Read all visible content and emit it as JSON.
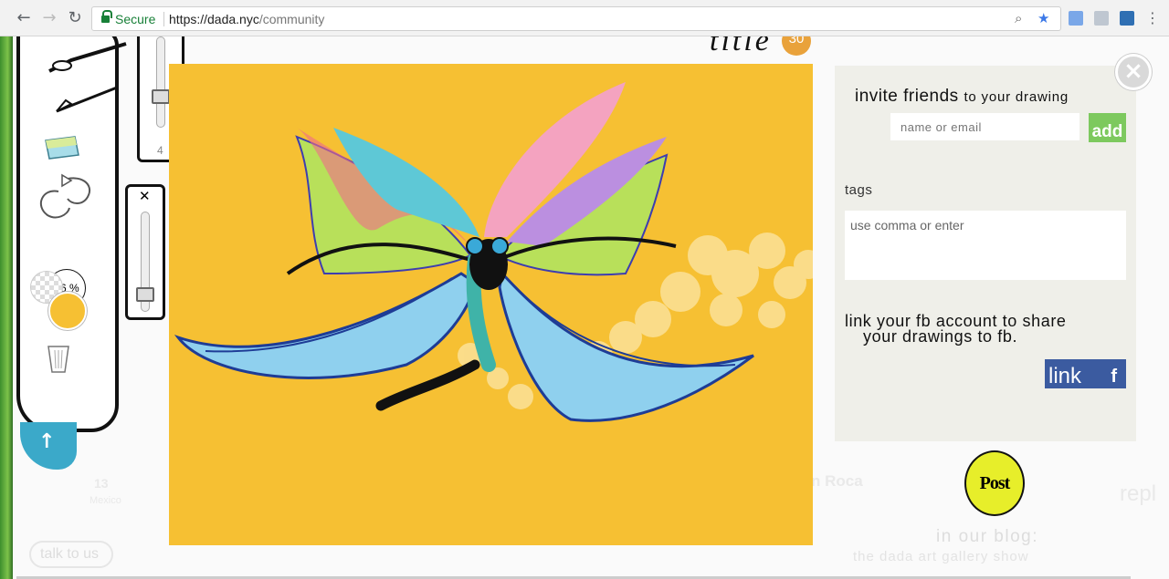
{
  "browser": {
    "secure_label": "Secure",
    "url_scheme_host": "https://dada.nyc",
    "url_path": "/community"
  },
  "toolbar": {
    "brush_size": "4",
    "zoom": "16 %",
    "color_swatch": "#f6c033",
    "close_symbol": "✕"
  },
  "header": {
    "title_word": "title",
    "counter": "30"
  },
  "panel": {
    "invite_main": "invite friends",
    "invite_suffix": "to your drawing",
    "invite_placeholder": "name or email",
    "add_label": "add",
    "tags_label": "tags",
    "tags_placeholder": "use comma or enter",
    "fb_line1": "link your fb account to share",
    "fb_line2": "your drawings to fb.",
    "link_label": "link",
    "link_icon": "f"
  },
  "post_label": "Post",
  "footer": {
    "blog_label": "in our blog:",
    "blog_sub": "the dada art gallery show",
    "talk_label": "talk to us"
  },
  "background": {
    "faint_number": "13",
    "faint_place": "Mexico",
    "faint_user": "n Roca",
    "faint_reply": "repl"
  },
  "colors": {
    "canvas": "#f6c033",
    "add_button": "#7dc95e",
    "fb_button": "#3b5ba0",
    "post_button": "#e7ee2a",
    "upload_button": "#3ba9c9"
  }
}
